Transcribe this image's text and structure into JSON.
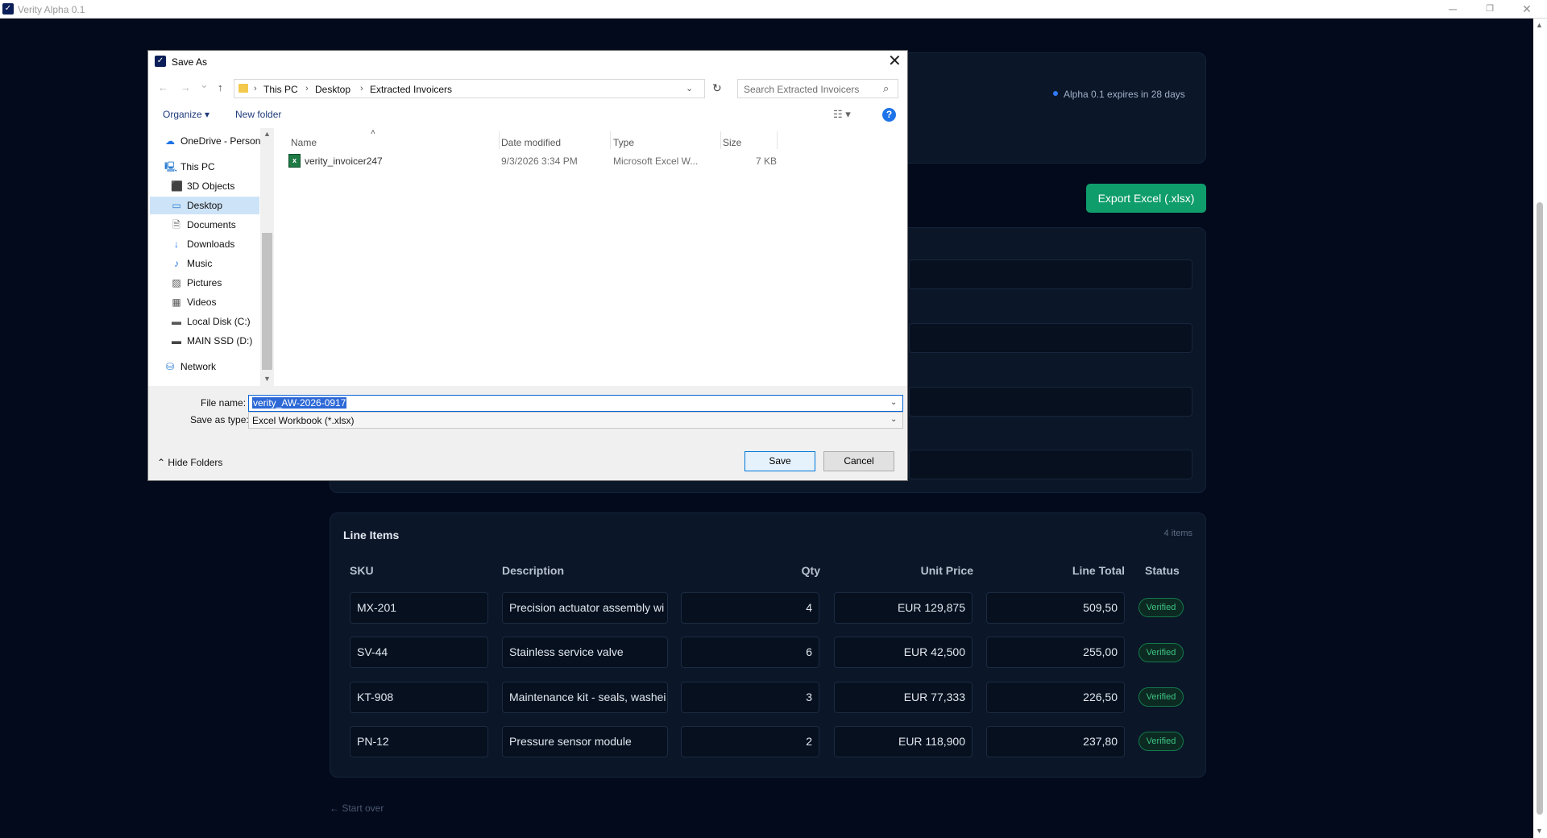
{
  "window": {
    "title": "Verity Alpha 0.1",
    "logo": "✓",
    "controls": {
      "minimize": "─",
      "restore": "❐",
      "close": "✕"
    }
  },
  "app": {
    "expiry_notice": "Alpha 0.1 expires in 28 days",
    "export_button": "Export Excel (.xlsx)",
    "line_items": {
      "title": "Line Items",
      "count": "4 items",
      "columns": [
        "SKU",
        "Description",
        "Qty",
        "Unit Price",
        "Line Total",
        "Status"
      ],
      "rows": [
        {
          "sku": "MX-201",
          "description": "Precision actuator assembly wi",
          "qty": "4",
          "unit_price": "EUR 129,875",
          "line_total": "509,50",
          "status": "Verified"
        },
        {
          "sku": "SV-44",
          "description": "Stainless service valve",
          "qty": "6",
          "unit_price": "EUR 42,500",
          "line_total": "255,00",
          "status": "Verified"
        },
        {
          "sku": "KT-908",
          "description": "Maintenance kit - seals, washei",
          "qty": "3",
          "unit_price": "EUR 77,333",
          "line_total": "226,50",
          "status": "Verified"
        },
        {
          "sku": "PN-12",
          "description": "Pressure sensor module",
          "qty": "2",
          "unit_price": "EUR 118,900",
          "line_total": "237,80",
          "status": "Verified"
        }
      ]
    },
    "start_over": "← Start over"
  },
  "dialog": {
    "title": "Save As",
    "close": "✕",
    "nav": {
      "back": "←",
      "forward": "→",
      "recent": "⌄",
      "up": "↑"
    },
    "breadcrumb": [
      "This PC",
      "Desktop",
      "Extracted Invoicers"
    ],
    "breadcrumb_sep": "›",
    "search_placeholder": "Search Extracted Invoicers",
    "organize": "Organize ▾",
    "new_folder": "New folder",
    "view_icon": "☷ ▾",
    "help": "?",
    "tree": [
      {
        "label": "OneDrive - Person",
        "icon": "☁"
      },
      {
        "label": "This PC",
        "icon": "🖳"
      },
      {
        "label": "3D Objects",
        "icon": "⬛"
      },
      {
        "label": "Desktop",
        "icon": "▭",
        "selected": true
      },
      {
        "label": "Documents",
        "icon": "🗎"
      },
      {
        "label": "Downloads",
        "icon": "↓"
      },
      {
        "label": "Music",
        "icon": "♪"
      },
      {
        "label": "Pictures",
        "icon": "▨"
      },
      {
        "label": "Videos",
        "icon": "▦"
      },
      {
        "label": "Local Disk (C:)",
        "icon": "▬"
      },
      {
        "label": "MAIN SSD (D:)",
        "icon": "▬"
      },
      {
        "label": "Network",
        "icon": "⛁"
      }
    ],
    "columns": {
      "name": "Name",
      "modified": "Date modified",
      "type": "Type",
      "size": "Size"
    },
    "files": [
      {
        "name": "verity_invoicer247",
        "modified": "9/3/2026 3:34 PM",
        "type": "Microsoft Excel W...",
        "size": "7 KB",
        "icon_text": "x"
      }
    ],
    "file_name_label": "File name:",
    "file_name_value": "verity_AW-2026-0917",
    "save_type_label": "Save as type:",
    "save_type_value": "Excel Workbook (*.xlsx)",
    "hide_folders": "⌃ Hide Folders",
    "save": "Save",
    "cancel": "Cancel"
  }
}
